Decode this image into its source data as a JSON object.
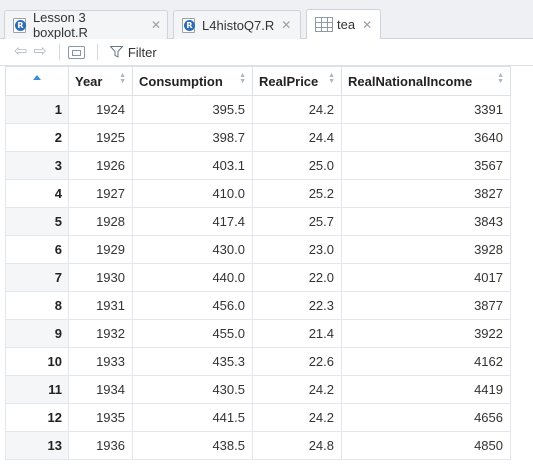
{
  "tabs": [
    {
      "label": "Lesson 3 boxplot.R",
      "icon": "r-file-icon",
      "active": false
    },
    {
      "label": "L4histoQ7.R",
      "icon": "r-file-icon",
      "active": false
    },
    {
      "label": "tea",
      "icon": "data-grid-icon",
      "active": true
    }
  ],
  "toolbar": {
    "filter_label": "Filter"
  },
  "table": {
    "columns": [
      "",
      "Year",
      "Consumption",
      "RealPrice",
      "RealNationalIncome"
    ],
    "rows": [
      [
        "1",
        "1924",
        "395.5",
        "24.2",
        "3391"
      ],
      [
        "2",
        "1925",
        "398.7",
        "24.4",
        "3640"
      ],
      [
        "3",
        "1926",
        "403.1",
        "25.0",
        "3567"
      ],
      [
        "4",
        "1927",
        "410.0",
        "25.2",
        "3827"
      ],
      [
        "5",
        "1928",
        "417.4",
        "25.7",
        "3843"
      ],
      [
        "6",
        "1929",
        "430.0",
        "23.0",
        "3928"
      ],
      [
        "7",
        "1930",
        "440.0",
        "22.0",
        "4017"
      ],
      [
        "8",
        "1931",
        "456.0",
        "22.3",
        "3877"
      ],
      [
        "9",
        "1932",
        "455.0",
        "21.4",
        "3922"
      ],
      [
        "10",
        "1933",
        "435.3",
        "22.6",
        "4162"
      ],
      [
        "11",
        "1934",
        "430.5",
        "24.2",
        "4419"
      ],
      [
        "12",
        "1935",
        "441.5",
        "24.2",
        "4656"
      ],
      [
        "13",
        "1936",
        "438.5",
        "24.8",
        "4850"
      ]
    ]
  },
  "colors": {
    "sort_accent": "#3a8fd6",
    "r_icon": "#2f6db5"
  }
}
